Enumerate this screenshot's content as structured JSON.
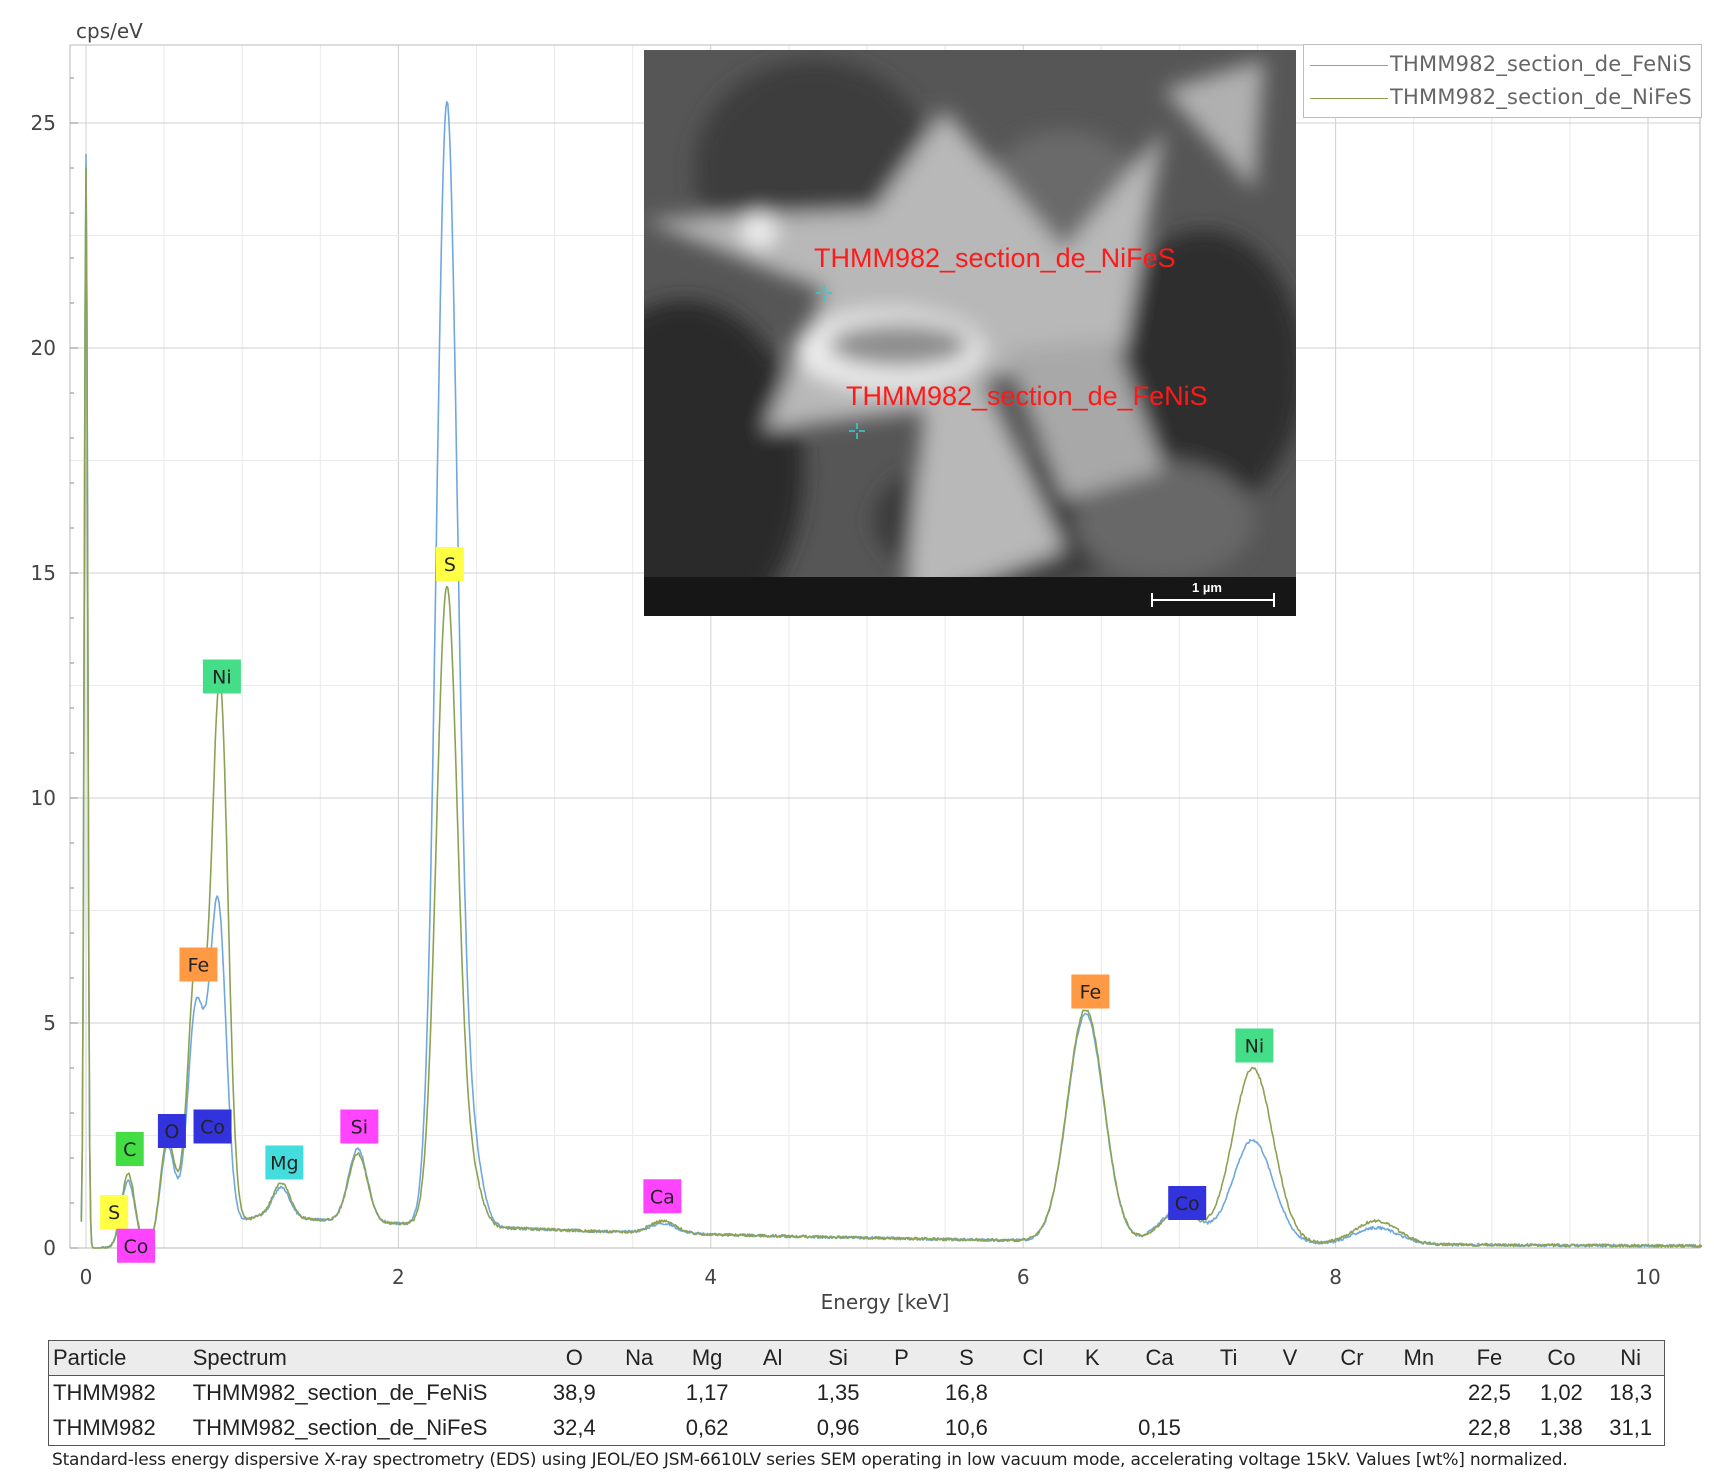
{
  "chart_data": {
    "type": "line",
    "ylabel": "cps/eV",
    "xlabel": "Energy [keV]",
    "xlim": [
      -0.1,
      10.35
    ],
    "ylim": [
      0,
      26.5
    ],
    "x_ticks": [
      0,
      2,
      4,
      6,
      8,
      10
    ],
    "y_ticks": [
      0,
      5,
      10,
      15,
      20,
      25
    ],
    "grid": true,
    "legend_position": "top-right",
    "series": [
      {
        "name": "THMM982_section_de_FeNiS",
        "color": "#6fa8dc",
        "points": [
          [
            0.0,
            24.3
          ],
          [
            0.27,
            1.5
          ],
          [
            0.52,
            2.2
          ],
          [
            0.62,
            0.6
          ],
          [
            0.7,
            4.8
          ],
          [
            0.78,
            2.0
          ],
          [
            0.85,
            7.1
          ],
          [
            1.25,
            1.35
          ],
          [
            1.74,
            2.2
          ],
          [
            2.31,
            25.3
          ],
          [
            2.46,
            2.3
          ],
          [
            3.69,
            0.55
          ],
          [
            6.4,
            5.2
          ],
          [
            7.0,
            0.85
          ],
          [
            7.47,
            2.4
          ],
          [
            8.26,
            0.45
          ],
          [
            10.35,
            0.0
          ]
        ]
      },
      {
        "name": "THMM982_section_de_NiFeS",
        "color": "#8ca252",
        "points": [
          [
            0.0,
            24.0
          ],
          [
            0.27,
            1.65
          ],
          [
            0.52,
            2.35
          ],
          [
            0.62,
            0.65
          ],
          [
            0.7,
            5.7
          ],
          [
            0.78,
            2.2
          ],
          [
            0.86,
            12.1
          ],
          [
            1.25,
            1.45
          ],
          [
            1.74,
            2.1
          ],
          [
            2.31,
            14.6
          ],
          [
            2.46,
            1.6
          ],
          [
            3.69,
            0.6
          ],
          [
            6.4,
            5.3
          ],
          [
            7.0,
            0.8
          ],
          [
            7.47,
            4.0
          ],
          [
            8.26,
            0.6
          ],
          [
            10.35,
            0.0
          ]
        ]
      }
    ],
    "peak_labels": [
      {
        "element": "S",
        "x": 0.18,
        "y": 0.8,
        "color": "#ffff44"
      },
      {
        "element": "Co",
        "x": 0.32,
        "y": 0.05,
        "color": "#ff44ff"
      },
      {
        "element": "C",
        "x": 0.28,
        "y": 2.2,
        "color": "#44dd44"
      },
      {
        "element": "O",
        "x": 0.55,
        "y": 2.6,
        "color": "#3333dd"
      },
      {
        "element": "Co",
        "x": 0.81,
        "y": 2.7,
        "color": "#3333dd"
      },
      {
        "element": "Fe",
        "x": 0.72,
        "y": 6.3,
        "color": "#ff9944"
      },
      {
        "element": "Ni",
        "x": 0.87,
        "y": 12.7,
        "color": "#44dd88"
      },
      {
        "element": "Mg",
        "x": 1.27,
        "y": 1.9,
        "color": "#44dddd"
      },
      {
        "element": "Si",
        "x": 1.75,
        "y": 2.7,
        "color": "#ff44ff"
      },
      {
        "element": "S",
        "x": 2.33,
        "y": 15.2,
        "color": "#ffff44"
      },
      {
        "element": "Ca",
        "x": 3.69,
        "y": 1.15,
        "color": "#ff44ff"
      },
      {
        "element": "Fe",
        "x": 6.43,
        "y": 5.7,
        "color": "#ff9944"
      },
      {
        "element": "Co",
        "x": 7.05,
        "y": 1.0,
        "color": "#3333dd"
      },
      {
        "element": "Ni",
        "x": 7.48,
        "y": 4.5,
        "color": "#44dd88"
      }
    ]
  },
  "sem_image": {
    "point_labels": [
      {
        "name": "THMM982_section_de_NiFeS"
      },
      {
        "name": "THMM982_section_de_FeNiS"
      }
    ],
    "scale_bar": "1 µm",
    "crosshair_color": "#33cccc"
  },
  "table": {
    "columns": [
      "Particle",
      "Spectrum",
      "O",
      "Na",
      "Mg",
      "Al",
      "Si",
      "P",
      "S",
      "Cl",
      "K",
      "Ca",
      "Ti",
      "V",
      "Cr",
      "Mn",
      "Fe",
      "Co",
      "Ni"
    ],
    "rows": [
      [
        "THMM982",
        "THMM982_section_de_FeNiS",
        "38,9",
        "",
        "1,17",
        "",
        "1,35",
        "",
        "16,8",
        "",
        "",
        "",
        "",
        "",
        "",
        "",
        "22,5",
        "1,02",
        "18,3"
      ],
      [
        "THMM982",
        "THMM982_section_de_NiFeS",
        "32,4",
        "",
        "0,62",
        "",
        "0,96",
        "",
        "10,6",
        "",
        "",
        "0,15",
        "",
        "",
        "",
        "",
        "22,8",
        "1,38",
        "31,1"
      ]
    ]
  },
  "caption": "Standard-less energy dispersive X-ray spectrometry (EDS) using JEOL/EO JSM-6610LV series SEM operating in low vacuum mode, accelerating voltage 15kV. Values [wt%] normalized."
}
